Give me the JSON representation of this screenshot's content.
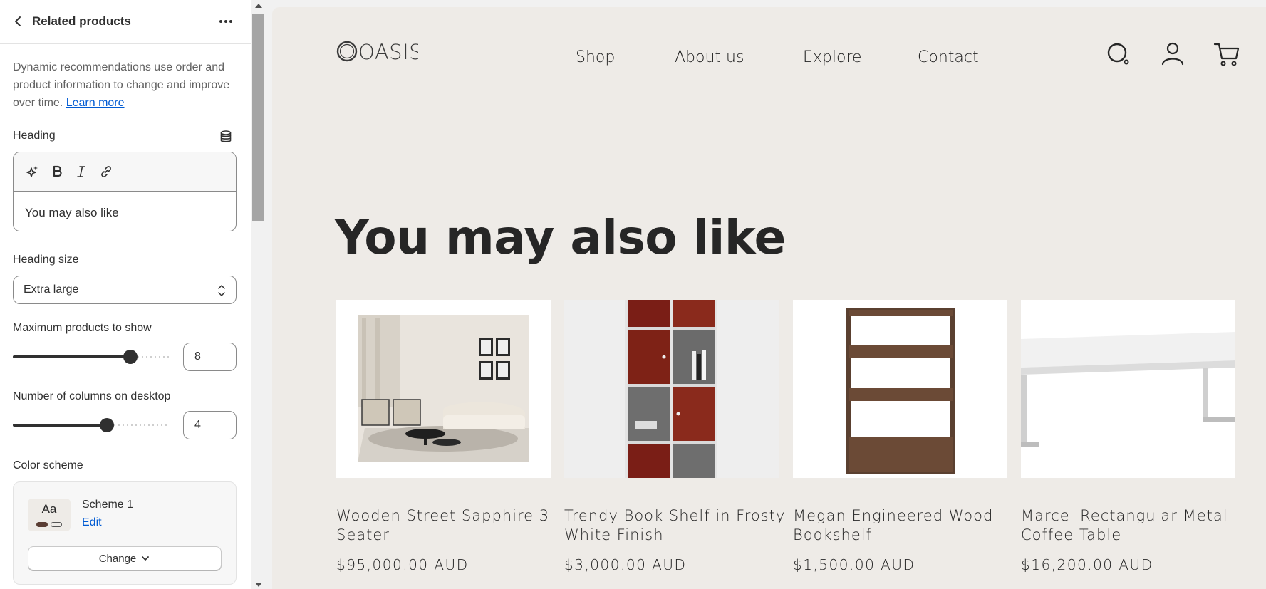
{
  "panel": {
    "title": "Related products",
    "description": "Dynamic recommendations use order and product information to change and improve over time.",
    "learn_more": "Learn more",
    "heading_label": "Heading",
    "heading_value": "You may also like",
    "heading_size_label": "Heading size",
    "heading_size_value": "Extra large",
    "max_products_label": "Maximum products to show",
    "max_products_value": "8",
    "max_products_fraction": 0.75,
    "columns_label": "Number of columns on desktop",
    "columns_value": "4",
    "columns_fraction": 0.6,
    "color_scheme_label": "Color scheme",
    "scheme_swatch_text": "Aa",
    "scheme_name": "Scheme 1",
    "scheme_edit": "Edit",
    "change_label": "Change"
  },
  "store": {
    "logo": "OASIS",
    "nav": [
      "Shop",
      "About us",
      "Explore",
      "Contact"
    ],
    "section_heading": "You may also like",
    "products": [
      {
        "title": "Wooden Street Sapphire 3 Seater",
        "price": "$95,000.00 AUD"
      },
      {
        "title": "Trendy Book Shelf in Frosty White Finish",
        "price": "$3,000.00 AUD"
      },
      {
        "title": "Megan Engineered Wood Bookshelf",
        "price": "$1,500.00 AUD"
      },
      {
        "title": "Marcel Rectangular Metal Coffee Table",
        "price": "$16,200.00 AUD"
      }
    ]
  },
  "colors": {
    "accent_link": "#005bd3",
    "preview_bg": "#eeebe7",
    "text_dark": "#262626"
  }
}
